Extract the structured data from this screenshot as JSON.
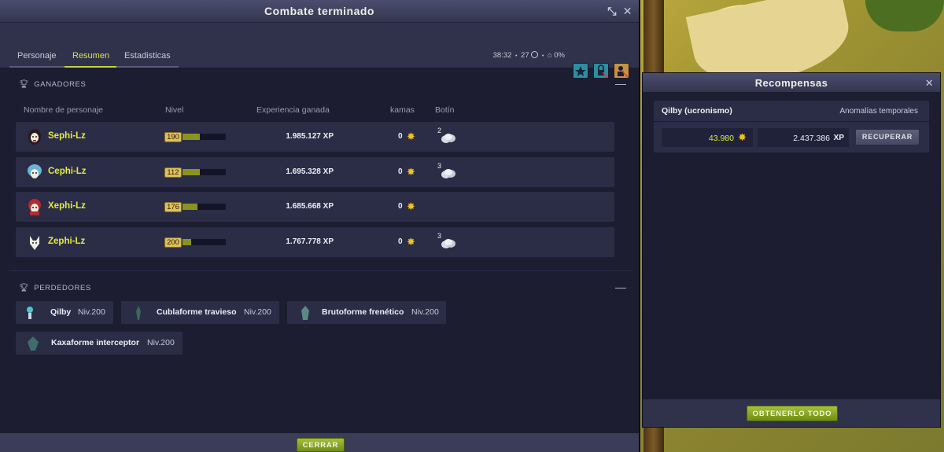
{
  "window": {
    "title": "Combate terminado",
    "minimize_glyph": "⤡",
    "close_glyph": "✕"
  },
  "tabs": [
    {
      "label": "Personaje"
    },
    {
      "label": "Resumen"
    },
    {
      "label": "Estadisticas"
    }
  ],
  "stats": {
    "time": "38:32",
    "turns": "27",
    "percent": "0%",
    "time_icon": "clock-icon",
    "percent_icon": "crystal-icon"
  },
  "winners": {
    "heading": "GANADORES",
    "collapse": "—",
    "columns": {
      "name": "Nombre de personaje",
      "level": "Nivel",
      "xp": "Experiencia ganada",
      "kamas": "kamas",
      "loot": "Botín"
    },
    "rows": [
      {
        "name": "Sephi-Lz",
        "level": "190",
        "level_progress": 0.4,
        "xp": "1.985.127",
        "xp_unit": "XP",
        "kamas": "0",
        "loot_count": "2",
        "has_loot": true
      },
      {
        "name": "Cephi-Lz",
        "level": "112",
        "level_progress": 0.4,
        "xp": "1.695.328",
        "xp_unit": "XP",
        "kamas": "0",
        "loot_count": "3",
        "has_loot": true
      },
      {
        "name": "Xephi-Lz",
        "level": "176",
        "level_progress": 0.35,
        "xp": "1.685.668",
        "xp_unit": "XP",
        "kamas": "0",
        "loot_count": "",
        "has_loot": false
      },
      {
        "name": "Zephi-Lz",
        "level": "200",
        "level_progress": 0.2,
        "xp": "1.767.778",
        "xp_unit": "XP",
        "kamas": "0",
        "loot_count": "3",
        "has_loot": true
      }
    ]
  },
  "losers": {
    "heading": "PERDEDORES",
    "collapse": "—",
    "items": [
      {
        "name": "Qilby",
        "level": "Niv.200"
      },
      {
        "name": "Cublaforme travieso",
        "level": "Niv.200"
      },
      {
        "name": "Brutoforme frenético",
        "level": "Niv.200"
      },
      {
        "name": "Kaxaforme interceptor",
        "level": "Niv.200"
      }
    ]
  },
  "footer": {
    "close_label": "CERRAR"
  },
  "rewards": {
    "title": "Recompensas",
    "close_glyph": "✕",
    "source_name": "Qilby (ucronismo)",
    "source_type": "Anomalías temporales",
    "kamas": "43.980",
    "xp": "2.437.386",
    "xp_unit": "XP",
    "recover_label": "RECUPERAR",
    "get_all_label": "OBTENERLO TODO"
  },
  "colors": {
    "accent_yellow": "#e3ec3b",
    "kamas_gold": "#f0c21c",
    "button_green": "#8aa82a"
  }
}
